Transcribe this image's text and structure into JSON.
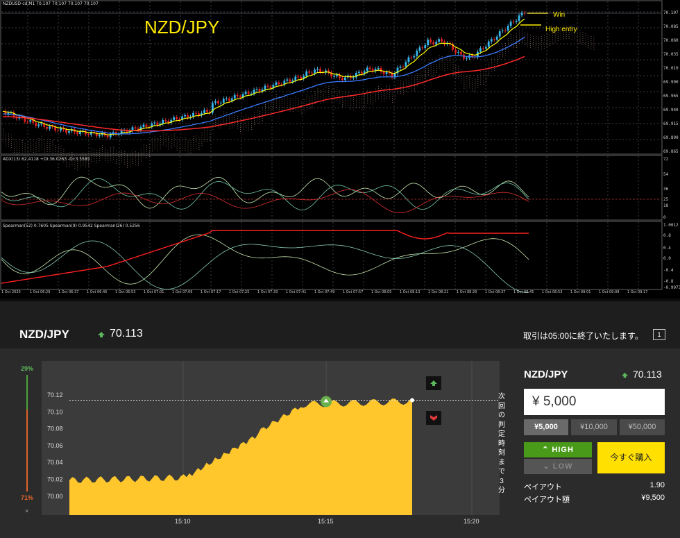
{
  "mt4": {
    "main_title": "NZDUSD-cd,M1  70.107 70.107 70.107 70.107",
    "pair_label": "NZD/JPY",
    "win_label": "Win",
    "entry_label": "High entry",
    "price_levels": [
      "70.107",
      "70.085",
      "70.060",
      "70.035",
      "70.010",
      "69.990",
      "69.965",
      "69.940",
      "69.915",
      "69.890",
      "69.865"
    ],
    "adx_title": "ADX(13) 62.4118 +DI:36.0263 -DI:3.5585",
    "adx_levels": [
      "72",
      "54",
      "36",
      "25",
      "18",
      "0"
    ],
    "spearman_title": "Spearman(52) 0.7605  Spearman(9) 0.9542  Spearman(26) 0.5256",
    "spearman_levels": [
      "1.0012",
      "0.8",
      "0.4",
      "0.0",
      "-0.4",
      "-0.8",
      "-0.9973"
    ],
    "time_labels": [
      "1 Oct 2020",
      "1 Oct 06:29",
      "1 Oct 06:37",
      "1 Oct 06:45",
      "1 Oct 06:53",
      "1 Oct 07:01",
      "1 Oct 07:09",
      "1 Oct 07:17",
      "1 Oct 07:25",
      "1 Oct 07:33",
      "1 Oct 07:41",
      "1 Oct 07:49",
      "1 Oct 07:57",
      "1 Oct 08:05",
      "1 Oct 08:13",
      "1 Oct 08:21",
      "1 Oct 08:29",
      "1 Oct 08:37",
      "1 Oct 08:45",
      "1 Oct 08:53",
      "1 Oct 09:01",
      "1 Oct 09:09",
      "1 Oct 09:17"
    ]
  },
  "header": {
    "pair": "NZD/JPY",
    "rate": "70.113",
    "notice": "取引は05:00に終了いたします。",
    "help": "1"
  },
  "sentiment": {
    "high_pct": "29%",
    "low_pct": "71%",
    "close": "×"
  },
  "chart": {
    "y_labels": [
      "70.12",
      "70.10",
      "70.08",
      "70.06",
      "70.04",
      "70.02",
      "70.00"
    ],
    "x_labels": [
      "15:10",
      "15:15",
      "15:20"
    ],
    "countdown": "次回の判定時刻まで3分",
    "strike": 70.113
  },
  "panel": {
    "pair": "NZD/JPY",
    "rate": "70.113",
    "amount": "¥ 5,000",
    "amount_options": [
      "¥5,000",
      "¥10,000",
      "¥50,000"
    ],
    "high": "HIGH",
    "low": "LOW",
    "buy": "今すぐ購入",
    "payout_label": "ペイアウト",
    "payout_value": "1.90",
    "payout_amount_label": "ペイアウト額",
    "payout_amount_value": "¥9,500"
  },
  "colors": {
    "up": "#5cb85c",
    "down": "#e03a3a",
    "area": "#ffc72c",
    "buy": "#ffe000",
    "high": "#4a9a1a",
    "ema_fast": "#ffff00",
    "ema_mid": "#3a7bff",
    "ema_slow": "#ff2a2a"
  }
}
